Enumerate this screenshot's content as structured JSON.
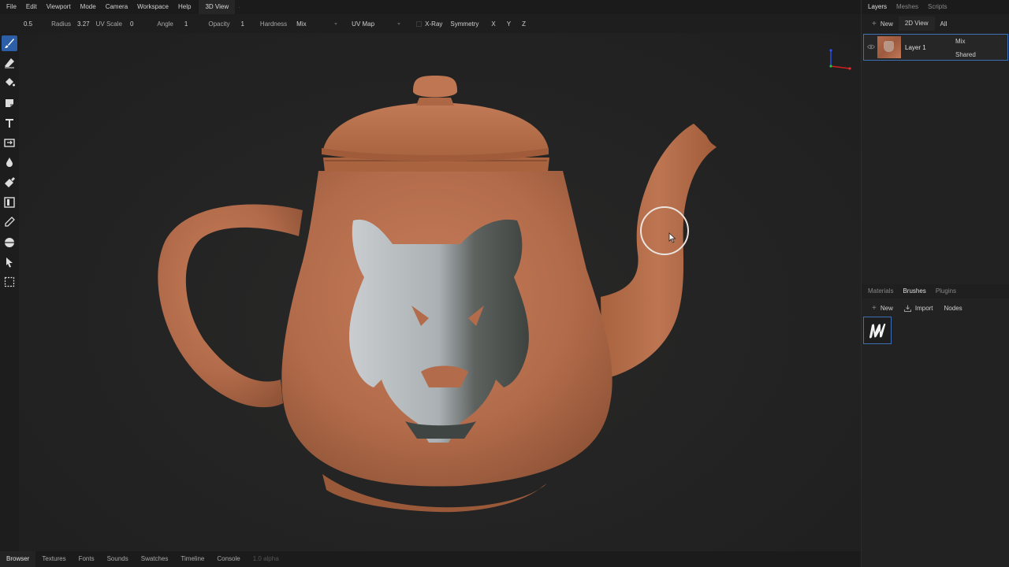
{
  "menu": {
    "items": [
      "File",
      "Edit",
      "Viewport",
      "Mode",
      "Camera",
      "Workspace",
      "Help"
    ],
    "view_tab": "3D View"
  },
  "toolbar": {
    "strength": "0.5",
    "radius_label": "Radius",
    "radius_value": "3.27",
    "uv_scale_label": "UV Scale",
    "uv_scale_value": "0",
    "angle_label": "Angle",
    "angle_value": "1",
    "opacity_label": "Opacity",
    "opacity_value": "1",
    "hardness_label": "Hardness",
    "blend_value": "Mix",
    "paint_mode": "UV Map",
    "xray_label": "X-Ray",
    "symmetry_label": "Symmetry",
    "sym_x": "X",
    "sym_y": "Y",
    "sym_z": "Z"
  },
  "left_tools": [
    "brush-icon",
    "eraser-icon",
    "fill-icon",
    "decal-icon",
    "text-icon",
    "clone-icon",
    "blur-icon",
    "smudge-icon",
    "particle-icon",
    "picker-icon",
    "bake-icon",
    "cursor-icon",
    "select-icon"
  ],
  "bottom_tabs": [
    "Browser",
    "Textures",
    "Fonts",
    "Sounds",
    "Swatches",
    "Timeline",
    "Console"
  ],
  "version": "1.0 alpha",
  "layers_panel": {
    "tabs": [
      "Layers",
      "Meshes",
      "Scripts"
    ],
    "new_label": "New",
    "view2d_label": "2D View",
    "filter_label": "All",
    "layer": {
      "name": "Layer 1",
      "blend": "Mix",
      "mask": "Shared"
    }
  },
  "materials_panel": {
    "tabs": [
      "Materials",
      "Brushes",
      "Plugins"
    ],
    "new_label": "New",
    "import_label": "Import",
    "nodes_label": "Nodes"
  },
  "colors": {
    "accent": "#3d6fb3",
    "clay": "#b8704e",
    "background": "#232323"
  }
}
